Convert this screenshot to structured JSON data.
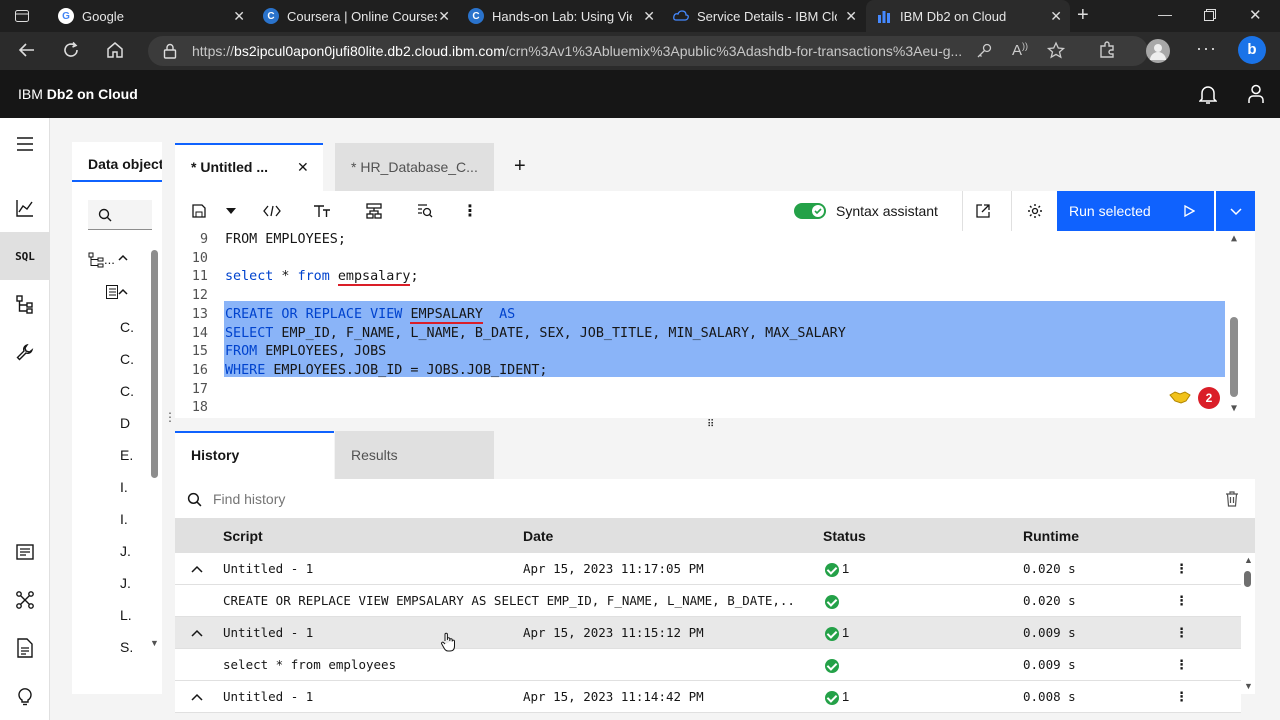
{
  "browser": {
    "tabs": [
      {
        "title": "Google",
        "icon": "google-icon",
        "active": false
      },
      {
        "title": "Coursera | Online Courses",
        "icon": "coursera-icon",
        "active": false
      },
      {
        "title": "Hands-on Lab: Using View",
        "icon": "coursera-icon",
        "active": false
      },
      {
        "title": "Service Details - IBM Clou",
        "icon": "ibm-cloud-icon",
        "active": false
      },
      {
        "title": "IBM Db2 on Cloud",
        "icon": "db2-icon",
        "active": true
      }
    ],
    "url_prefix": "https://",
    "url_host": "bs2ipcul0apon0jufi80lite.db2.cloud.ibm.com",
    "url_path": "/crn%3Av1%3Abluemix%3Apublic%3Adashdb-for-transactions%3Aeu-g..."
  },
  "app": {
    "title_light": "IBM ",
    "title_bold": "Db2",
    "title_rest": " on Cloud"
  },
  "objects": {
    "tab_label": "Data objects",
    "items": [
      "C.",
      "C.",
      "C.",
      "D",
      "E.",
      "I.",
      "I.",
      "J.",
      "J.",
      "L.",
      "S."
    ],
    "tree_label": "..."
  },
  "editor": {
    "tabs": [
      "* Untitled ...",
      "* HR_Database_C..."
    ],
    "syntax_assistant_label": "Syntax assistant",
    "run_label": "Run selected",
    "badge_count": "2",
    "lines": [
      {
        "n": "9",
        "parts": [
          {
            "t": "FROM EMPLOYEES;",
            "c": ""
          }
        ]
      },
      {
        "n": "10",
        "parts": []
      },
      {
        "n": "11",
        "parts": [
          {
            "t": "select",
            "c": "kw"
          },
          {
            "t": " * ",
            "c": ""
          },
          {
            "t": "from",
            "c": "kw"
          },
          {
            "t": " ",
            "c": ""
          },
          {
            "t": "empsalary",
            "c": "ul"
          },
          {
            "t": ";",
            "c": ""
          }
        ]
      },
      {
        "n": "12",
        "parts": []
      },
      {
        "n": "13",
        "sel": true,
        "parts": [
          {
            "t": "CREATE OR REPLACE VIEW",
            "c": "kw"
          },
          {
            "t": " ",
            "c": ""
          },
          {
            "t": "EMPSALARY",
            "c": "ul"
          },
          {
            "t": "  ",
            "c": ""
          },
          {
            "t": "AS",
            "c": "kw"
          }
        ]
      },
      {
        "n": "14",
        "sel": true,
        "parts": [
          {
            "t": "SELECT",
            "c": "kw"
          },
          {
            "t": " EMP_ID, F_NAME, L_NAME, B_DATE, SEX, JOB_TITLE, MIN_SALARY, MAX_SALARY",
            "c": ""
          }
        ]
      },
      {
        "n": "15",
        "sel": true,
        "parts": [
          {
            "t": "FROM",
            "c": "kw"
          },
          {
            "t": " EMPLOYEES, JOBS",
            "c": ""
          }
        ]
      },
      {
        "n": "16",
        "sel": true,
        "parts": [
          {
            "t": "WHERE",
            "c": "kw"
          },
          {
            "t": " EMPLOYEES.JOB_ID = JOBS.JOB_IDENT;",
            "c": ""
          }
        ]
      },
      {
        "n": "17",
        "parts": []
      },
      {
        "n": "18",
        "parts": []
      }
    ]
  },
  "history": {
    "tabs": [
      "History",
      "Results"
    ],
    "search_placeholder": "Find history",
    "columns": [
      "Script",
      "Date",
      "Status",
      "Runtime"
    ],
    "rows": [
      {
        "kind": "group",
        "script": "Untitled - 1",
        "date": "Apr 15, 2023 11:17:05 PM",
        "status": "1",
        "runtime": "0.020 s"
      },
      {
        "kind": "child",
        "script": "CREATE OR REPLACE VIEW EMPSALARY AS SELECT EMP_ID, F_NAME, L_NAME, B_DATE,...",
        "date": "",
        "status": "",
        "runtime": "0.020 s"
      },
      {
        "kind": "group",
        "script": "Untitled - 1",
        "date": "Apr 15, 2023 11:15:12 PM",
        "status": "1",
        "runtime": "0.009 s"
      },
      {
        "kind": "child",
        "script": "select * from employees",
        "date": "",
        "status": "",
        "runtime": "0.009 s"
      },
      {
        "kind": "group",
        "script": "Untitled - 1",
        "date": "Apr 15, 2023 11:14:42 PM",
        "status": "1",
        "runtime": "0.008 s"
      }
    ]
  },
  "colors": {
    "accent": "#0f62fe",
    "success": "#24a148",
    "selection": "#8ab4f8",
    "badge": "#da1e28"
  }
}
